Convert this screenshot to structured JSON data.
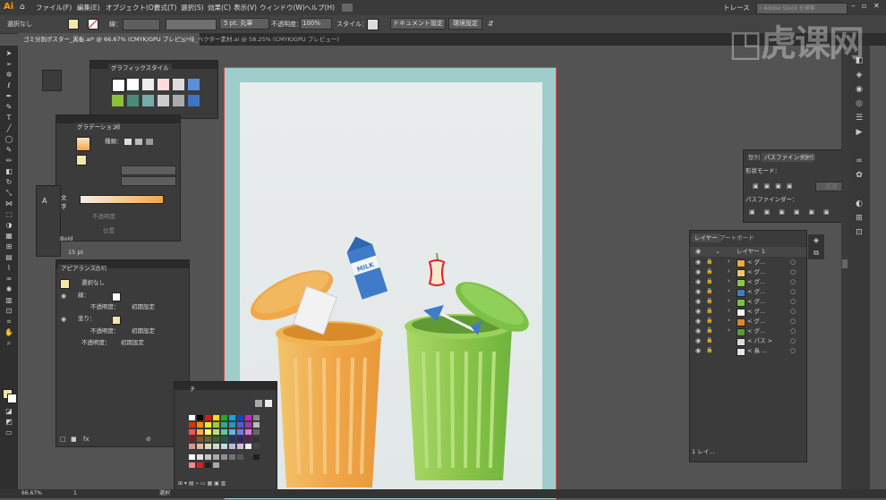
{
  "app": {
    "logo": "Ai"
  },
  "menu": [
    "ファイル(F)",
    "編集(E)",
    "オブジェクト(O)",
    "書式(T)",
    "選択(S)",
    "効果(C)",
    "表示(V)",
    "ウィンドウ(W)",
    "ヘルプ(H)"
  ],
  "control": {
    "selection": "選択なし",
    "stroke_label": "線：",
    "stroke_profile": "5 pt. 丸筆",
    "opacity_label": "不透明度：",
    "opacity_value": "100%",
    "style_label": "スタイル：",
    "doc_settings": "ドキュメント設定",
    "prefs": "環境設定",
    "trace": "トレース",
    "stock_placeholder": "Adobe Stock を検索"
  },
  "tabs": [
    "ゴミ分別ポスター_黒板.ai* @ 66.67% (CMYK/GPU プレビュー)",
    "ゴミ箱_ベクター素材.ai @ 58.25% (CMYK/GPU プレビュー)"
  ],
  "graphic_styles": {
    "title": "グラフィックスタイル"
  },
  "gradient": {
    "tab1": "グラデーション",
    "tab2": "線",
    "type_label": "種類：",
    "opacity_label": "不透明度",
    "position_label": "位置"
  },
  "char": {
    "tab": "文字",
    "font": "Bold",
    "size": "15 pt"
  },
  "appearance": {
    "tab1": "アピアランス",
    "tab2": "透明",
    "rows": [
      {
        "label": "選択なし"
      },
      {
        "label": "線：",
        "indent": false
      },
      {
        "label": "不透明度：",
        "value": "初期設定"
      },
      {
        "label": "塗り：",
        "indent": false
      },
      {
        "label": "不透明度：",
        "value": "初期設定"
      },
      {
        "label": "不透明度：",
        "value": "初期設定"
      }
    ]
  },
  "swatches": {
    "tab": "チ"
  },
  "pathfinder": {
    "tab1": "整列",
    "tab2": "パスファインダー",
    "tab3": "変形",
    "shape_modes": "形状モード：",
    "expand": "拡張",
    "pathfinders": "パスファインダー："
  },
  "layers": {
    "tab1": "レイヤー",
    "tab2": "アートボード",
    "layer_name": "レイヤー 1",
    "items": [
      "< グ...",
      "< グ...",
      "< グ...",
      "< グ...",
      "< グ...",
      "< グ...",
      "< グ...",
      "< グ...",
      "< パス >",
      "< 長 ..."
    ],
    "footer": "1 レイ..."
  },
  "status": {
    "zoom": "66.67%",
    "page": "1",
    "tool": "選択"
  },
  "artwork": {
    "milk_label": "MILK"
  }
}
